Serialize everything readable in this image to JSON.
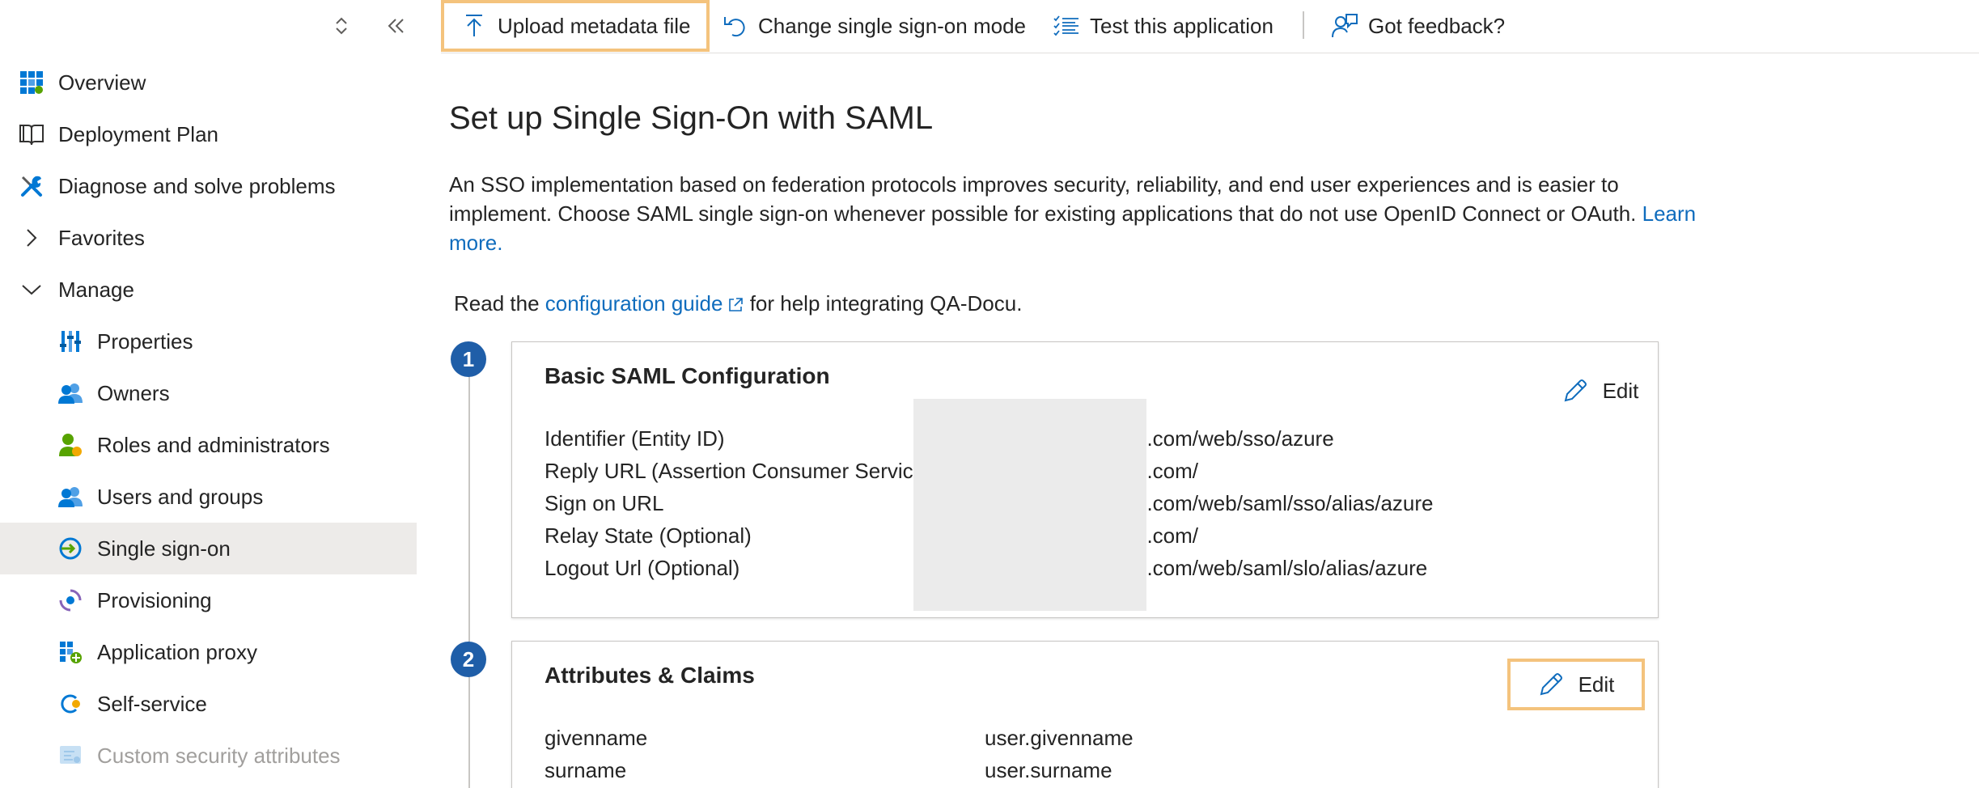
{
  "sidebar": {
    "items": [
      {
        "label": "Overview",
        "icon": "overview-grid-icon"
      },
      {
        "label": "Deployment Plan",
        "icon": "book-icon"
      },
      {
        "label": "Diagnose and solve problems",
        "icon": "wrench-icon"
      },
      {
        "label": "Favorites",
        "icon": "chevron-right-icon"
      },
      {
        "label": "Manage",
        "icon": "chevron-down-icon"
      },
      {
        "label": "Properties",
        "icon": "properties-icon"
      },
      {
        "label": "Owners",
        "icon": "users-icon"
      },
      {
        "label": "Roles and administrators",
        "icon": "user-admin-icon"
      },
      {
        "label": "Users and groups",
        "icon": "users-icon"
      },
      {
        "label": "Single sign-on",
        "icon": "sso-icon",
        "selected": true
      },
      {
        "label": "Provisioning",
        "icon": "provisioning-icon"
      },
      {
        "label": "Application proxy",
        "icon": "app-proxy-icon"
      },
      {
        "label": "Self-service",
        "icon": "self-service-icon"
      },
      {
        "label": "Custom security attributes",
        "icon": "security-attributes-icon",
        "disabled": true
      }
    ]
  },
  "toolbar": {
    "upload": "Upload metadata file",
    "change_mode": "Change single sign-on mode",
    "test": "Test this application",
    "feedback": "Got feedback?"
  },
  "main": {
    "title": "Set up Single Sign-On with SAML",
    "intro_text": "An SSO implementation based on federation protocols improves security, reliability, and end user experiences and is easier to implement. Choose SAML single sign-on whenever possible for existing applications that do not use OpenID Connect or OAuth. ",
    "intro_link": "Learn more.",
    "guide_prefix": "Read the ",
    "guide_link": "configuration guide",
    "guide_suffix": " for help integrating QA-Docu."
  },
  "steps": [
    {
      "number": "1",
      "title": "Basic SAML Configuration",
      "edit_label": "Edit",
      "rows": [
        {
          "label": "Identifier (Entity ID)",
          "value": "4.com/web/sso/azure"
        },
        {
          "label": "Reply URL (Assertion Consumer Service",
          "value": "4.com/"
        },
        {
          "label": "Sign on URL",
          "value": "4.com/web/saml/sso/alias/azure"
        },
        {
          "label": "Relay State (Optional)",
          "value": "4.com/"
        },
        {
          "label": "Logout Url (Optional)",
          "value": "4.com/web/saml/slo/alias/azure"
        }
      ]
    },
    {
      "number": "2",
      "title": "Attributes & Claims",
      "edit_label": "Edit",
      "rows": [
        {
          "label": "givenname",
          "value": "user.givenname"
        },
        {
          "label": "surname",
          "value": "user.surname"
        }
      ]
    }
  ],
  "colors": {
    "accent": "#0f6cbd",
    "highlight": "#f4c37d",
    "badge": "#1f5ea8",
    "selected_bg": "#edebe9"
  }
}
